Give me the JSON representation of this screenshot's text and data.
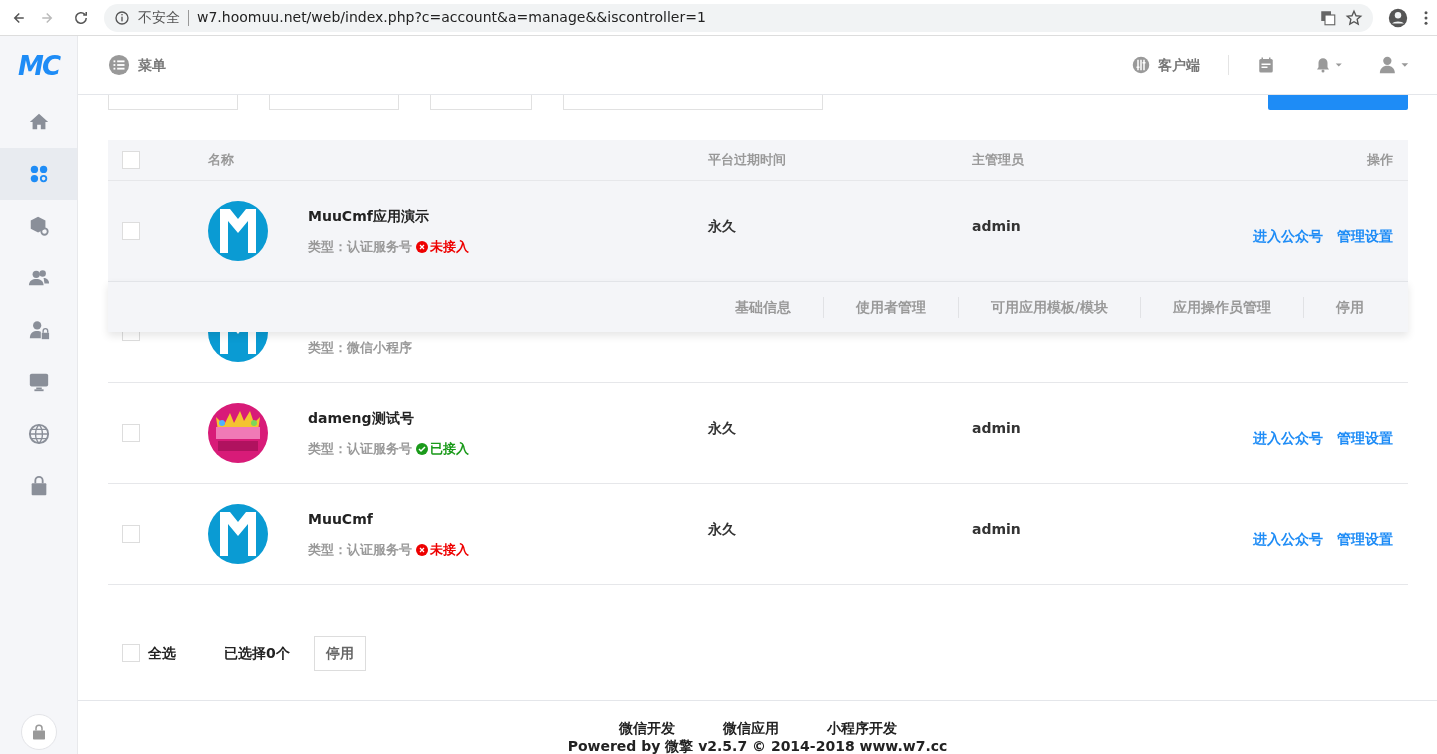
{
  "browser": {
    "nav_buttons": [
      {
        "disabled": false
      },
      {
        "disabled": true
      },
      {
        "disabled": false
      }
    ],
    "security_label": "不安全",
    "url": "w7.hoomuu.net/web/index.php?c=account&a=manage&&iscontroller=1"
  },
  "sidebar": {
    "logo": "MC",
    "items": [
      {
        "selected": false
      },
      {
        "selected": true
      },
      {
        "selected": false
      },
      {
        "selected": false
      },
      {
        "selected": false
      },
      {
        "selected": false
      },
      {
        "selected": false
      },
      {
        "selected": false
      }
    ]
  },
  "header": {
    "menu_label": "菜单",
    "client_label": "客户端"
  },
  "table": {
    "header_checked": false,
    "columns": [
      "名称",
      "平台过期时间",
      "主管理员",
      "操作"
    ],
    "rows": [
      {
        "checked": false,
        "avatar": {
          "kind": "logo"
        },
        "name": "MuuCmf应用演示",
        "type": "类型：认证服务号",
        "status": {
          "text": "未接入",
          "connected": false
        },
        "expiry": "永久",
        "admin": "admin",
        "actions": [
          "进入公众号",
          "管理设置"
        ],
        "menu": [
          "基础信息",
          "使用者管理",
          "可用应用模板/模块",
          "应用操作员管理",
          "停用"
        ]
      },
      {
        "checked": false,
        "avatar": {
          "kind": "logo"
        },
        "type": "类型：微信小程序"
      },
      {
        "checked": false,
        "avatar": {
          "kind": "picture"
        },
        "name": "dameng测试号",
        "type": "类型：认证服务号",
        "status": {
          "text": "已接入",
          "connected": true
        },
        "expiry": "永久",
        "admin": "admin",
        "actions": [
          "进入公众号",
          "管理设置"
        ]
      },
      {
        "checked": false,
        "avatar": {
          "kind": "logo"
        },
        "name": "MuuCmf",
        "type": "类型：认证服务号",
        "status": {
          "text": "未接入",
          "connected": false
        },
        "expiry": "永久",
        "admin": "admin",
        "actions": [
          "进入公众号",
          "管理设置"
        ]
      }
    ]
  },
  "bulk": {
    "select_all": {
      "label": "全选",
      "checked": false
    },
    "selected_count": "已选择0个",
    "button": "停用"
  },
  "footer": {
    "links": [
      "微信开发",
      "微信应用",
      "小程序开发"
    ],
    "powered": "Powered by 微擎 v2.5.7 © 2014-2018 www.w7.cc"
  }
}
